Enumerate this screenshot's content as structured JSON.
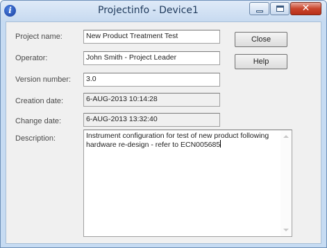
{
  "window": {
    "title": "Projectinfo - Device1",
    "icon": "info-icon",
    "controls": {
      "minimize": "minimize-icon",
      "maximize": "maximize-icon",
      "close": "close-icon",
      "close_glyph": "✕"
    }
  },
  "form": {
    "project_name": {
      "label": "Project name:",
      "value": "New Product Treatment Test"
    },
    "operator": {
      "label": "Operator:",
      "value": "John Smith - Project Leader"
    },
    "version_number": {
      "label": "Version number:",
      "value": "3.0"
    },
    "creation_date": {
      "label": "Creation date:",
      "value": "6-AUG-2013 10:14:28"
    },
    "change_date": {
      "label": "Change date:",
      "value": "6-AUG-2013 13:32:40"
    },
    "description": {
      "label": "Description:",
      "value": "Instrument configuration for test of new product following hardware re-design - refer to ECN005685"
    }
  },
  "buttons": {
    "close": "Close",
    "help": "Help"
  },
  "colors": {
    "title_text": "#1e395b",
    "close_button": "#c9452c",
    "dialog_background": "#f0f0f0"
  }
}
